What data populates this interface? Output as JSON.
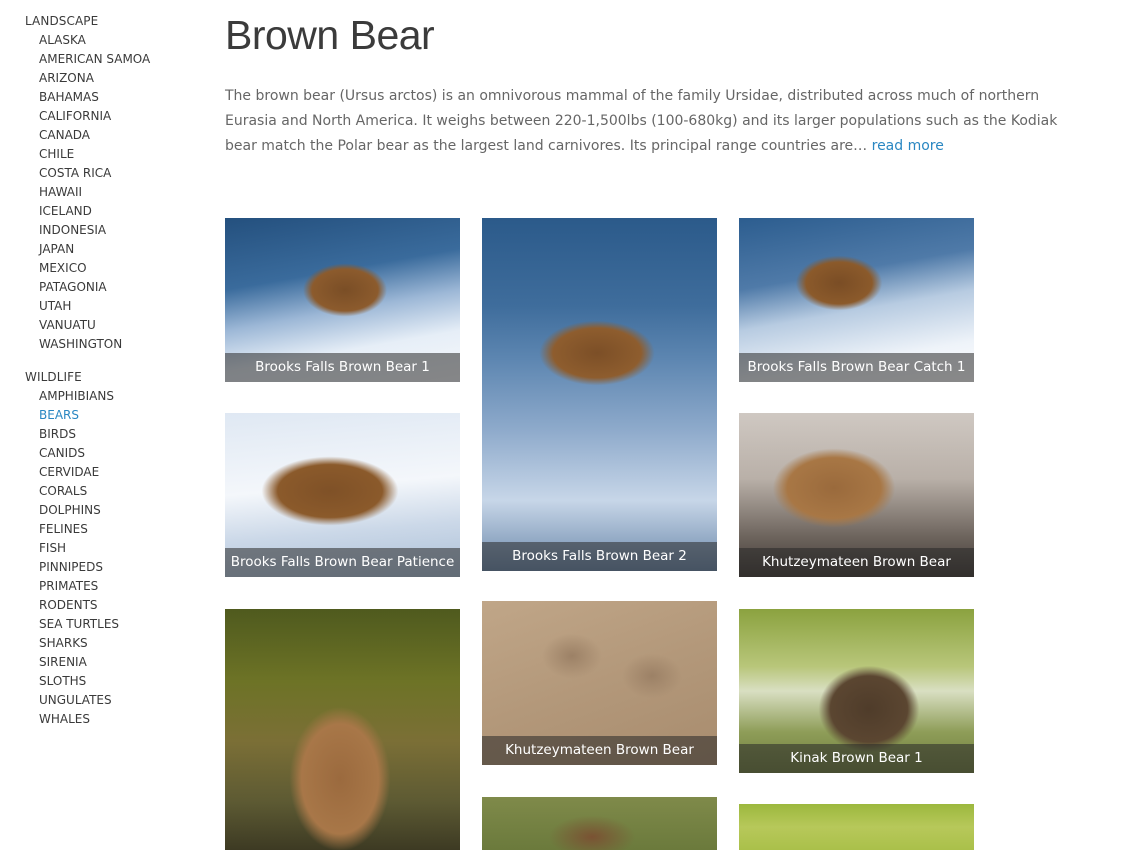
{
  "sidebar": {
    "groups": [
      {
        "heading": "LANDSCAPE",
        "items": [
          "ALASKA",
          "AMERICAN SAMOA",
          "ARIZONA",
          "BAHAMAS",
          "CALIFORNIA",
          "CANADA",
          "CHILE",
          "COSTA RICA",
          "HAWAII",
          "ICELAND",
          "INDONESIA",
          "JAPAN",
          "MEXICO",
          "PATAGONIA",
          "UTAH",
          "VANUATU",
          "WASHINGTON"
        ]
      },
      {
        "heading": "WILDLIFE",
        "items": [
          "AMPHIBIANS",
          "BEARS",
          "BIRDS",
          "CANIDS",
          "CERVIDAE",
          "CORALS",
          "DOLPHINS",
          "FELINES",
          "FISH",
          "PINNIPEDS",
          "PRIMATES",
          "RODENTS",
          "SEA TURTLES",
          "SHARKS",
          "SIRENIA",
          "SLOTHS",
          "UNGULATES",
          "WHALES"
        ]
      }
    ],
    "active_item": "BEARS",
    "active_color": "#2a87c2"
  },
  "page": {
    "title": "Brown Bear",
    "intro": "The brown bear (Ursus arctos) is an omnivorous mammal of the family Ursidae, distributed across much of northern Eurasia and North America. It weighs between 220-1,500lbs (100-680kg) and its larger populations such as the Kodiak bear match the Polar bear as the largest land carnivores. Its principal range countries are… ",
    "read_more": "read more"
  },
  "gallery": {
    "tiles": [
      {
        "caption": "Brooks Falls Brown Bear 1",
        "photo": "waterfall-bear-photo"
      },
      {
        "caption": "Brooks Falls Brown Bear 2",
        "photo": "waterfall-bear-photo"
      },
      {
        "caption": "Brooks Falls Brown Bear Catch 1",
        "photo": "waterfall-bear-catch-photo"
      },
      {
        "caption": "Brooks Falls Brown Bear Patience",
        "photo": "waterfall-bear-closeup-photo"
      },
      {
        "caption": "Khutzeymateen Brown Bear",
        "photo": "shore-bear-photo"
      },
      {
        "caption": "",
        "photo": "grass-bear-photo"
      },
      {
        "caption": "Khutzeymateen Brown Bear",
        "photo": "bear-tracks-photo"
      },
      {
        "caption": "Kinak Brown Bear 1",
        "photo": "bear-cubs-photo"
      },
      {
        "caption": "",
        "photo": "bear-splash-photo"
      },
      {
        "caption": "",
        "photo": "green-meadow-photo"
      }
    ]
  }
}
